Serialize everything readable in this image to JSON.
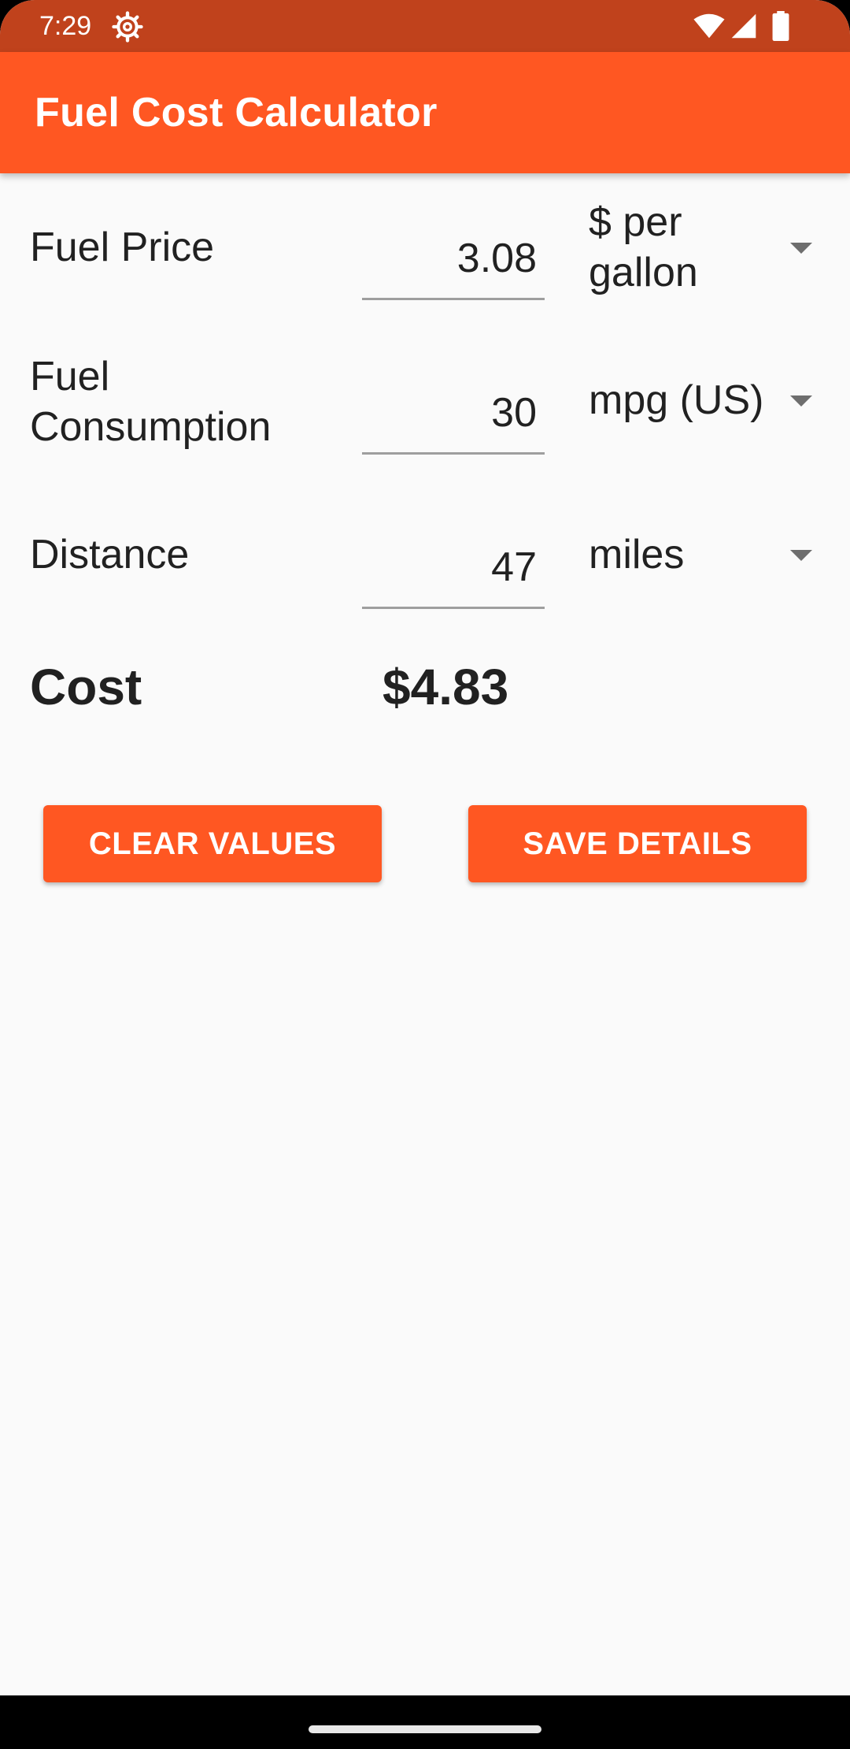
{
  "status_bar": {
    "time": "7:29",
    "icons": [
      "settings-icon",
      "wifi-icon",
      "signal-icon",
      "battery-icon"
    ]
  },
  "app_bar": {
    "title": "Fuel Cost Calculator"
  },
  "form": {
    "fuel_price": {
      "label": "Fuel Price",
      "value": "3.08",
      "unit": "$ per gallon"
    },
    "fuel_consumption": {
      "label": "Fuel Consumption",
      "value": "30",
      "unit": "mpg (US)"
    },
    "distance": {
      "label": "Distance",
      "value": "47",
      "unit": "miles"
    }
  },
  "result": {
    "label": "Cost",
    "value": "$4.83"
  },
  "buttons": {
    "clear": "CLEAR VALUES",
    "save": "SAVE DETAILS"
  },
  "colors": {
    "primary": "#ff5722",
    "primary_dark": "#c0421c",
    "background": "#fafafa",
    "text": "#212121"
  }
}
